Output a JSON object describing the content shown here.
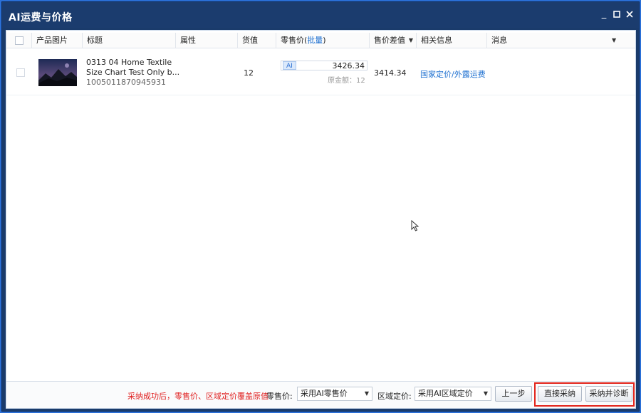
{
  "window": {
    "title": "AI运费与价格"
  },
  "table": {
    "columns": [
      "产品图片",
      "标题",
      "属性",
      "货值",
      "零售价(",
      "批量",
      ")",
      "售价差值",
      "相关信息",
      "消息"
    ],
    "rows": [
      {
        "title_line1": "0313 04 Home Textile",
        "title_line2": "Size Chart Test Only b...",
        "product_id": "1005011870945931",
        "stock": "12",
        "ai_badge": "AI",
        "retail_price": "3426.34",
        "original_amount": "原金额：12",
        "price_diff": "3414.34",
        "related_info": "国家定价/外露运费"
      }
    ]
  },
  "footer": {
    "notice": "采纳成功后，零售价、区域定价覆盖原值",
    "retail_label": "零售价:",
    "retail_select": "采用AI零售价",
    "region_label": "区域定价:",
    "region_select": "采用AI区域定价",
    "prev_button": "上一步",
    "adopt_button": "直接采纳",
    "adopt_diagnose_button": "采纳并诊断"
  },
  "colors": {
    "titlebar": "#1b3c6e",
    "link": "#1c6fd0",
    "notice": "#e02020",
    "highlight": "#e2231a"
  }
}
